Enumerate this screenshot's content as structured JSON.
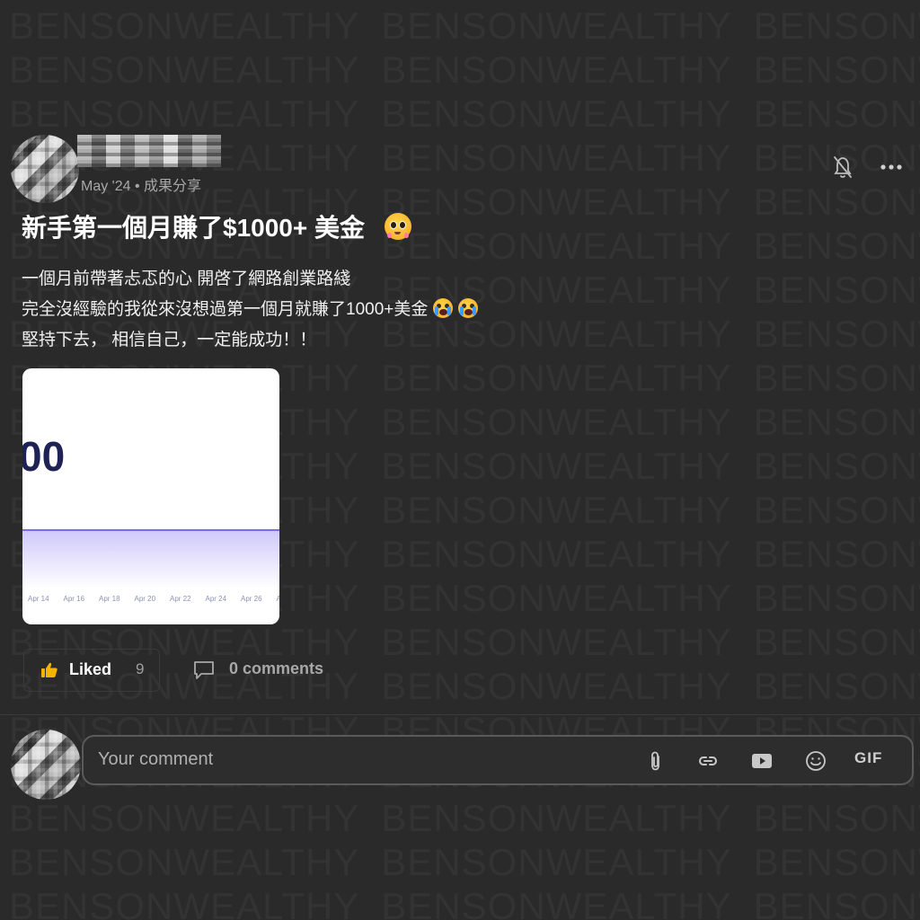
{
  "watermark": {
    "text": "BENSONWEALTHY"
  },
  "post": {
    "meta": "May '24 • 成果分享",
    "title": "新手第一個月賺了$1000+ 美金",
    "body_lines": [
      "一個月前帶著忐忑的心 開啓了網路創業路綫",
      "完全沒經驗的我從來沒想過第一個月就賺了1000+美金",
      "堅持下去， 相信自己，一定能成功！！"
    ],
    "image": {
      "big_text": "00",
      "x_ticks": [
        "Apr 14",
        "Apr 16",
        "Apr 18",
        "Apr 20",
        "Apr 22",
        "Apr 24",
        "Apr 26",
        "A"
      ]
    },
    "icons": {
      "bell": "bell-off-icon",
      "more": "more-horizontal-icon",
      "title_emoji": "pleading-face-emoji",
      "body_emoji": "loudly-crying-face-emoji"
    }
  },
  "actions": {
    "like_label": "Liked",
    "like_count": "9",
    "comments_label": "0 comments"
  },
  "comment_box": {
    "placeholder": "Your comment",
    "tools": [
      "attach-icon",
      "link-icon",
      "video-icon",
      "emoji-icon"
    ],
    "gif_label": "GIF"
  },
  "colors": {
    "background": "#2a2a2a",
    "like_accent": "#f5b400",
    "chart_line": "#7b6cf6"
  }
}
